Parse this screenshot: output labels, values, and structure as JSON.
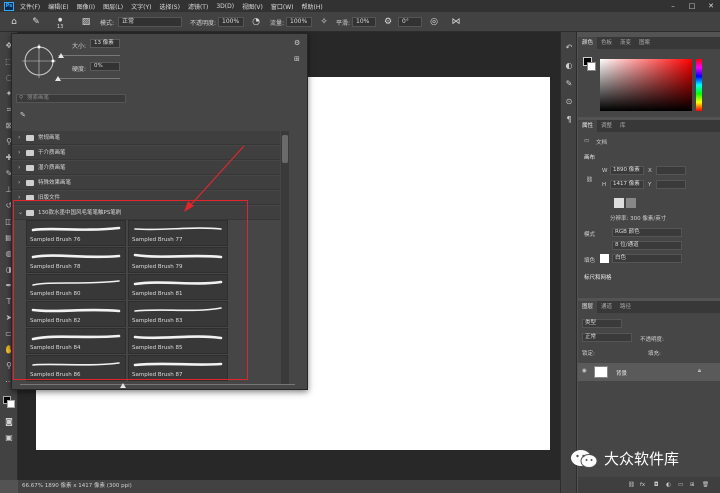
{
  "menu": {
    "items": [
      "文件(F)",
      "编辑(E)",
      "图像(I)",
      "图层(L)",
      "文字(Y)",
      "选择(S)",
      "滤镜(T)",
      "3D(D)",
      "视图(V)",
      "窗口(W)",
      "帮助(H)"
    ]
  },
  "options": {
    "brush_size": "13",
    "mode_label": "模式:",
    "mode_value": "正常",
    "opacity_label": "不透明度:",
    "opacity_value": "100%",
    "flow_label": "流量:",
    "flow_value": "100%",
    "smooth_label": "平滑:",
    "smooth_value": "10%",
    "angle_value": "0°"
  },
  "brush_popup": {
    "size_label": "大小:",
    "size_value": "13 像素",
    "hardness_label": "硬度:",
    "hardness_value": "0%",
    "search_placeholder": "搜索画笔",
    "folders": [
      "常规画笔",
      "干介质画笔",
      "湿介质画笔",
      "特殊效果画笔",
      "旧版文件",
      "130款水墨中国风毛笔笔触PS笔刷"
    ],
    "brushes": [
      "Sampled Brush 76",
      "Sampled Brush 77",
      "Sampled Brush 78",
      "Sampled Brush 79",
      "Sampled Brush 80",
      "Sampled Brush 81",
      "Sampled Brush 82",
      "Sampled Brush 83",
      "Sampled Brush 84",
      "Sampled Brush 85",
      "Sampled Brush 86",
      "Sampled Brush 87"
    ]
  },
  "color_panel": {
    "tabs": [
      "颜色",
      "色板",
      "渐变",
      "图案"
    ]
  },
  "properties_panel": {
    "tabs": [
      "属性",
      "调整",
      "库"
    ],
    "doc_label": "文档",
    "canvas_section": "画布",
    "w_label": "W",
    "w_value": "1890 像素",
    "x_label": "X",
    "h_label": "H",
    "h_value": "1417 像素",
    "y_label": "Y",
    "resolution": "分辨率: 300 像素/英寸",
    "mode_label": "模式",
    "mode_value": "RGB 颜色",
    "depth_value": "8 位/通道",
    "fill_label": "填色",
    "fill_value": "白色",
    "rulers_section": "标尺和网格"
  },
  "layers_panel": {
    "tabs": [
      "图层",
      "通道",
      "路径"
    ],
    "kind_placeholder": "类型",
    "blend_value": "正常",
    "opacity_label": "不透明度:",
    "lock_label": "锁定:",
    "fill_label": "填充:",
    "layer_name": "背景"
  },
  "status": {
    "text": "66.67%    1890 像素 x 1417 像素 (300 ppi)"
  },
  "watermark": {
    "text": "大众软件库"
  },
  "colors": {
    "annotation_red": "#e0262c",
    "ps_blue": "#31a8ff"
  }
}
